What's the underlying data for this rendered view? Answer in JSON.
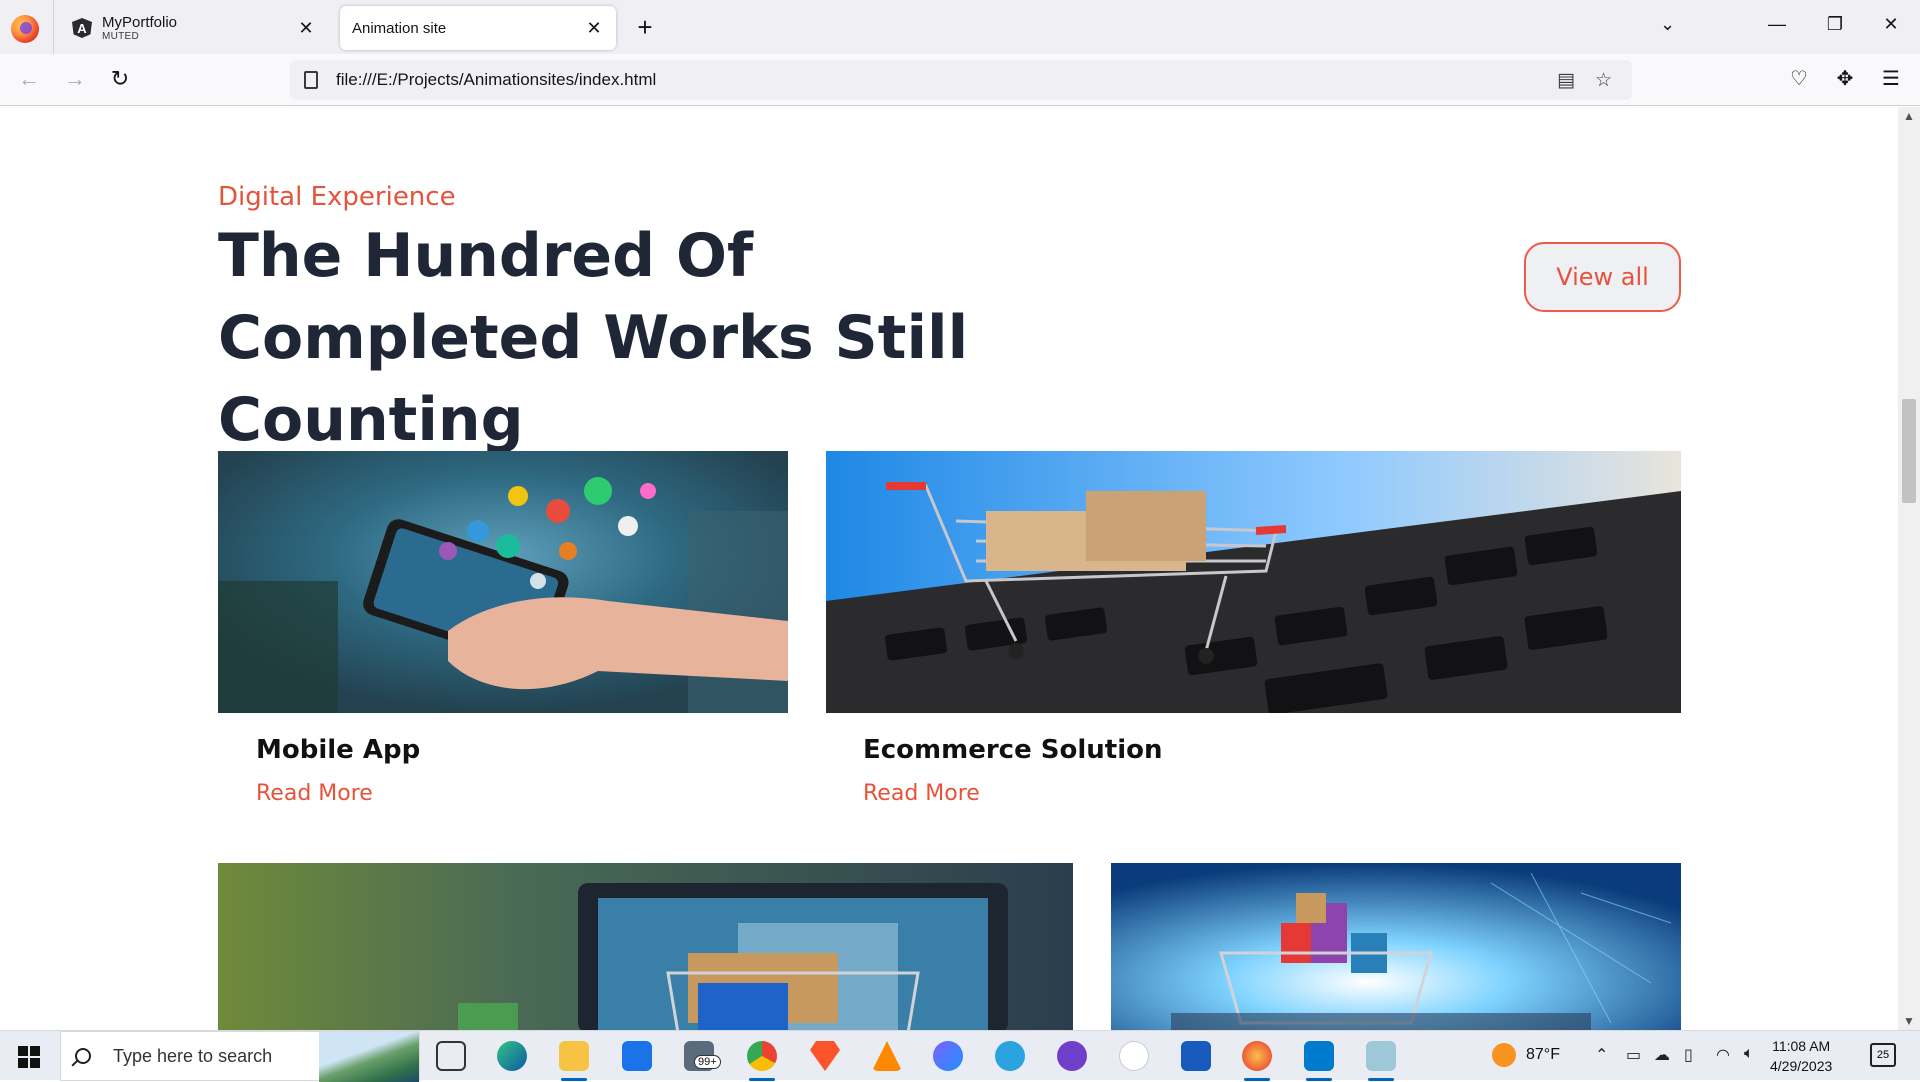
{
  "browser": {
    "tabs": [
      {
        "title": "MyPortfolio",
        "sub": "MUTED",
        "icon": "angular-icon"
      },
      {
        "title": "Animation site",
        "icon": ""
      }
    ],
    "url": "file:///E:/Projects/Animationsites/index.html"
  },
  "page": {
    "subtitle": "Digital Experience",
    "heading": "The Hundred Of Completed Works Still Counting",
    "view_all": "View all",
    "cards": [
      {
        "title": "Mobile App",
        "link": "Read More"
      },
      {
        "title": "Ecommerce Solution",
        "link": "Read More"
      }
    ]
  },
  "taskbar": {
    "search_placeholder": "Type here to search",
    "mail_badge": "99+",
    "weather": "87°F",
    "time": "11:08 AM",
    "date": "4/29/2023",
    "notifications": "25"
  }
}
